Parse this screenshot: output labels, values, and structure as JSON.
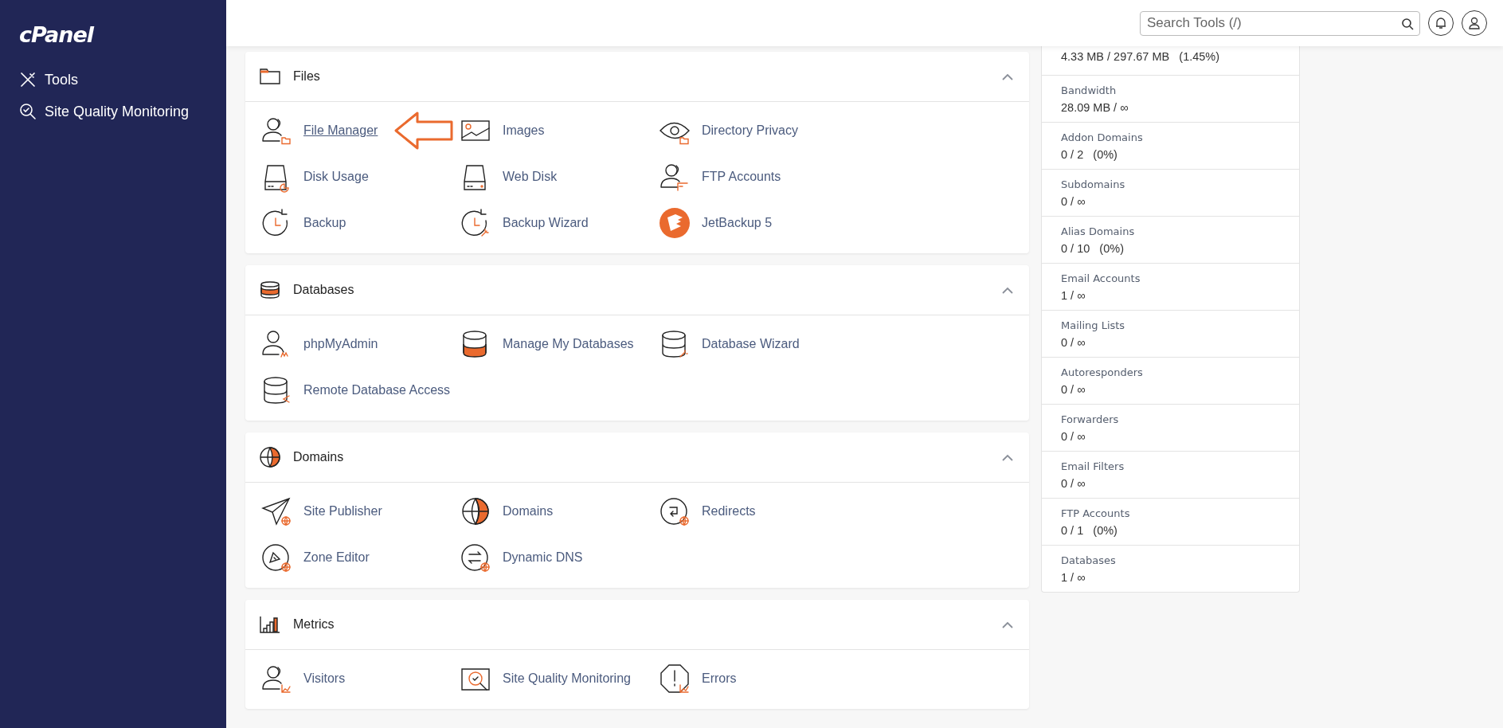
{
  "sidebar": {
    "logo": "cPanel",
    "items": [
      {
        "label": "Tools",
        "selected": false
      },
      {
        "label": "Site Quality Monitoring",
        "selected": false
      }
    ]
  },
  "topbar": {
    "search": {
      "placeholder": "Search Tools (/)"
    }
  },
  "sections": [
    {
      "title": "Files",
      "expanded": true,
      "items": [
        {
          "label": "File Manager",
          "hovered": true
        },
        {
          "label": "Images",
          "hovered": false
        },
        {
          "label": "Directory Privacy",
          "hovered": false
        },
        {
          "label": "Disk Usage",
          "hovered": false
        },
        {
          "label": "Web Disk",
          "hovered": false
        },
        {
          "label": "FTP Accounts",
          "hovered": false
        },
        {
          "label": "Backup",
          "hovered": false
        },
        {
          "label": "Backup Wizard",
          "hovered": false
        },
        {
          "label": "JetBackup 5",
          "hovered": false
        }
      ]
    },
    {
      "title": "Databases",
      "expanded": true,
      "items": [
        {
          "label": "phpMyAdmin",
          "hovered": false
        },
        {
          "label": "Manage My Databases",
          "hovered": false
        },
        {
          "label": "Database Wizard",
          "hovered": false
        },
        {
          "label": "Remote Database Access",
          "hovered": false
        }
      ]
    },
    {
      "title": "Domains",
      "expanded": true,
      "items": [
        {
          "label": "Site Publisher",
          "hovered": false
        },
        {
          "label": "Domains",
          "hovered": false
        },
        {
          "label": "Redirects",
          "hovered": false
        },
        {
          "label": "Zone Editor",
          "hovered": false
        },
        {
          "label": "Dynamic DNS",
          "hovered": false
        }
      ]
    },
    {
      "title": "Metrics",
      "expanded": true,
      "items": [
        {
          "label": "Visitors",
          "hovered": false
        },
        {
          "label": "Site Quality Monitoring",
          "hovered": false
        },
        {
          "label": "Errors",
          "hovered": false
        }
      ]
    }
  ],
  "stats": [
    {
      "value": "4.33 MB / 297.67 MB   (1.45%)"
    },
    {
      "label": "Bandwidth",
      "value": "28.09 MB / ∞"
    },
    {
      "label": "Addon Domains",
      "value": "0 / 2   (0%)"
    },
    {
      "label": "Subdomains",
      "value": "0 / ∞"
    },
    {
      "label": "Alias Domains",
      "value": "0 / 10   (0%)"
    },
    {
      "label": "Email Accounts",
      "value": "1 / ∞"
    },
    {
      "label": "Mailing Lists",
      "value": "0 / ∞"
    },
    {
      "label": "Autoresponders",
      "value": "0 / ∞"
    },
    {
      "label": "Forwarders",
      "value": "0 / ∞"
    },
    {
      "label": "Email Filters",
      "value": "0 / ∞"
    },
    {
      "label": "FTP Accounts",
      "value": "0 / 1   (0%)"
    },
    {
      "label": "Databases",
      "value": "1 / ∞"
    }
  ]
}
